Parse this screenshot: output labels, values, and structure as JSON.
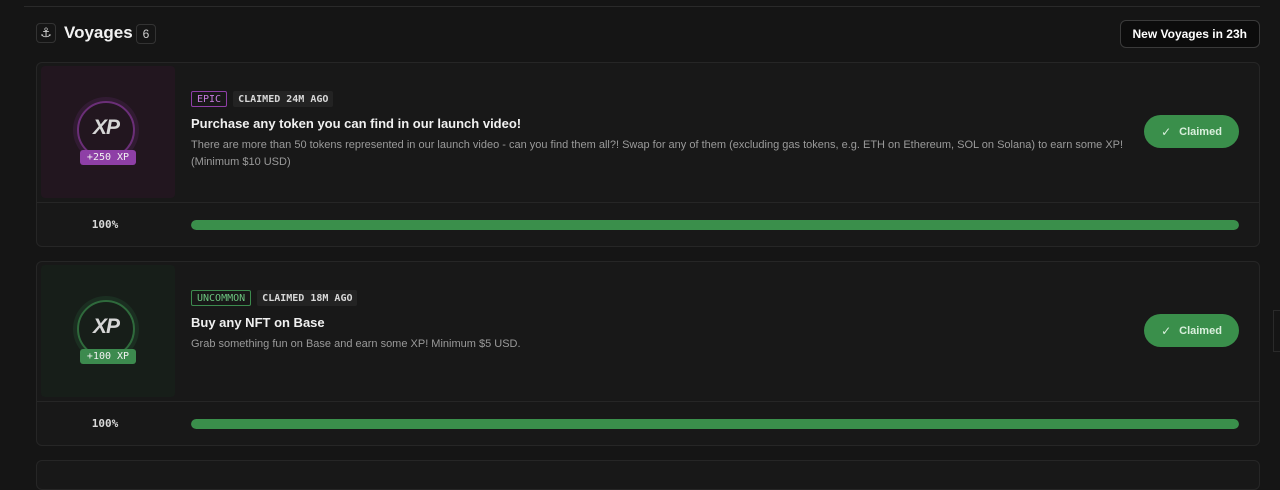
{
  "header": {
    "title": "Voyages",
    "count": "6",
    "anchor_icon": "anchor-icon",
    "new_voyages_label": "New Voyages in 23h"
  },
  "voyages": [
    {
      "rarity": "EPIC",
      "rarity_color": "#8e3fa6",
      "claimed_status": "CLAIMED 24M AGO",
      "xp_label": "XP",
      "xp_reward": "+250 XP",
      "title": "Purchase any token you can find in our launch video!",
      "description": "There are more than 50 tokens represented in our launch video - can you find them all?! Swap for any of them (excluding gas tokens, e.g. ETH on Ethereum, SOL on Solana) to earn some XP! (Minimum $10 USD)",
      "button_label": "Claimed",
      "progress_label": "100%",
      "progress": 1.0
    },
    {
      "rarity": "UNCOMMON",
      "rarity_color": "#3c8a4e",
      "claimed_status": "CLAIMED 18M AGO",
      "xp_label": "XP",
      "xp_reward": "+100 XP",
      "title": "Buy any NFT on Base",
      "description": "Grab something fun on Base and earn some XP! Minimum $5 USD.",
      "button_label": "Claimed",
      "progress_label": "100%",
      "progress": 1.0
    }
  ],
  "colors": {
    "accent_green": "#3a8f4b",
    "background": "#151515"
  }
}
